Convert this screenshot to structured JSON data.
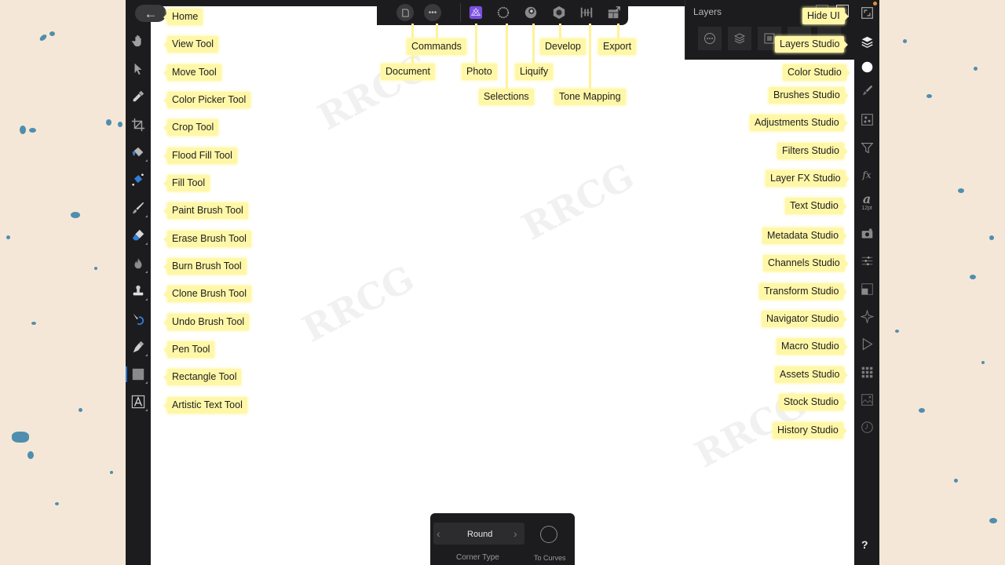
{
  "home": {
    "label": "Home",
    "icon": "back-arrow-icon"
  },
  "left_tools": [
    {
      "label": "View Tool",
      "icon": "hand-icon"
    },
    {
      "label": "Move Tool",
      "icon": "arrow-pointer-icon"
    },
    {
      "label": "Color Picker Tool",
      "icon": "eyedropper-icon"
    },
    {
      "label": "Crop Tool",
      "icon": "crop-icon"
    },
    {
      "label": "Flood Fill Tool",
      "icon": "paint-bucket-icon"
    },
    {
      "label": "Fill Tool",
      "icon": "gradient-fill-icon"
    },
    {
      "label": "Paint Brush Tool",
      "icon": "paint-brush-icon"
    },
    {
      "label": "Erase Brush Tool",
      "icon": "eraser-icon"
    },
    {
      "label": "Burn Brush Tool",
      "icon": "flame-icon"
    },
    {
      "label": "Clone Brush Tool",
      "icon": "stamp-icon"
    },
    {
      "label": "Undo Brush Tool",
      "icon": "undo-brush-icon"
    },
    {
      "label": "Pen Tool",
      "icon": "pen-nib-icon"
    },
    {
      "label": "Rectangle Tool",
      "icon": "rectangle-icon"
    },
    {
      "label": "Artistic Text Tool",
      "icon": "text-tool-icon"
    }
  ],
  "top_bar": {
    "labels": {
      "document": "Document",
      "commands": "Commands",
      "photo": "Photo",
      "selections": "Selections",
      "liquify": "Liquify",
      "develop": "Develop",
      "tone_mapping": "Tone Mapping",
      "export": "Export"
    },
    "icons": [
      "document-icon",
      "more-commands-icon",
      "photo-persona-icon",
      "selections-persona-icon",
      "liquify-persona-icon",
      "develop-persona-icon",
      "tone-mapping-persona-icon",
      "export-persona-icon"
    ],
    "accent_color": "#7b4fe0"
  },
  "layers_panel": {
    "title": "Layers",
    "hide_ui_label": "Hide UI",
    "layers_studio_label": "Layers Studio"
  },
  "right_studios": [
    {
      "label": "Color Studio",
      "icon": "color-circle-icon"
    },
    {
      "label": "Brushes Studio",
      "icon": "brush-icon"
    },
    {
      "label": "Adjustments Studio",
      "icon": "adjustments-icon"
    },
    {
      "label": "Filters Studio",
      "icon": "filter-funnel-icon"
    },
    {
      "label": "Layer FX Studio",
      "icon": "fx-icon"
    },
    {
      "label": "Text Studio",
      "icon": "text-icon",
      "sub": "12pt"
    },
    {
      "label": "Metadata Studio",
      "icon": "camera-icon"
    },
    {
      "label": "Channels Studio",
      "icon": "channels-sliders-icon"
    },
    {
      "label": "Transform Studio",
      "icon": "transform-icon"
    },
    {
      "label": "Navigator Studio",
      "icon": "navigator-compass-icon"
    },
    {
      "label": "Macro Studio",
      "icon": "play-icon"
    },
    {
      "label": "Assets Studio",
      "icon": "grid-icon"
    },
    {
      "label": "Stock Studio",
      "icon": "image-icon"
    },
    {
      "label": "History Studio",
      "icon": "clock-icon"
    }
  ],
  "context_toolbar": {
    "corner_type_value": "Round",
    "corner_type_label": "Corner Type",
    "to_curves_label": "To Curves"
  },
  "help": {
    "label": "?"
  },
  "watermark_text": "RRCG"
}
